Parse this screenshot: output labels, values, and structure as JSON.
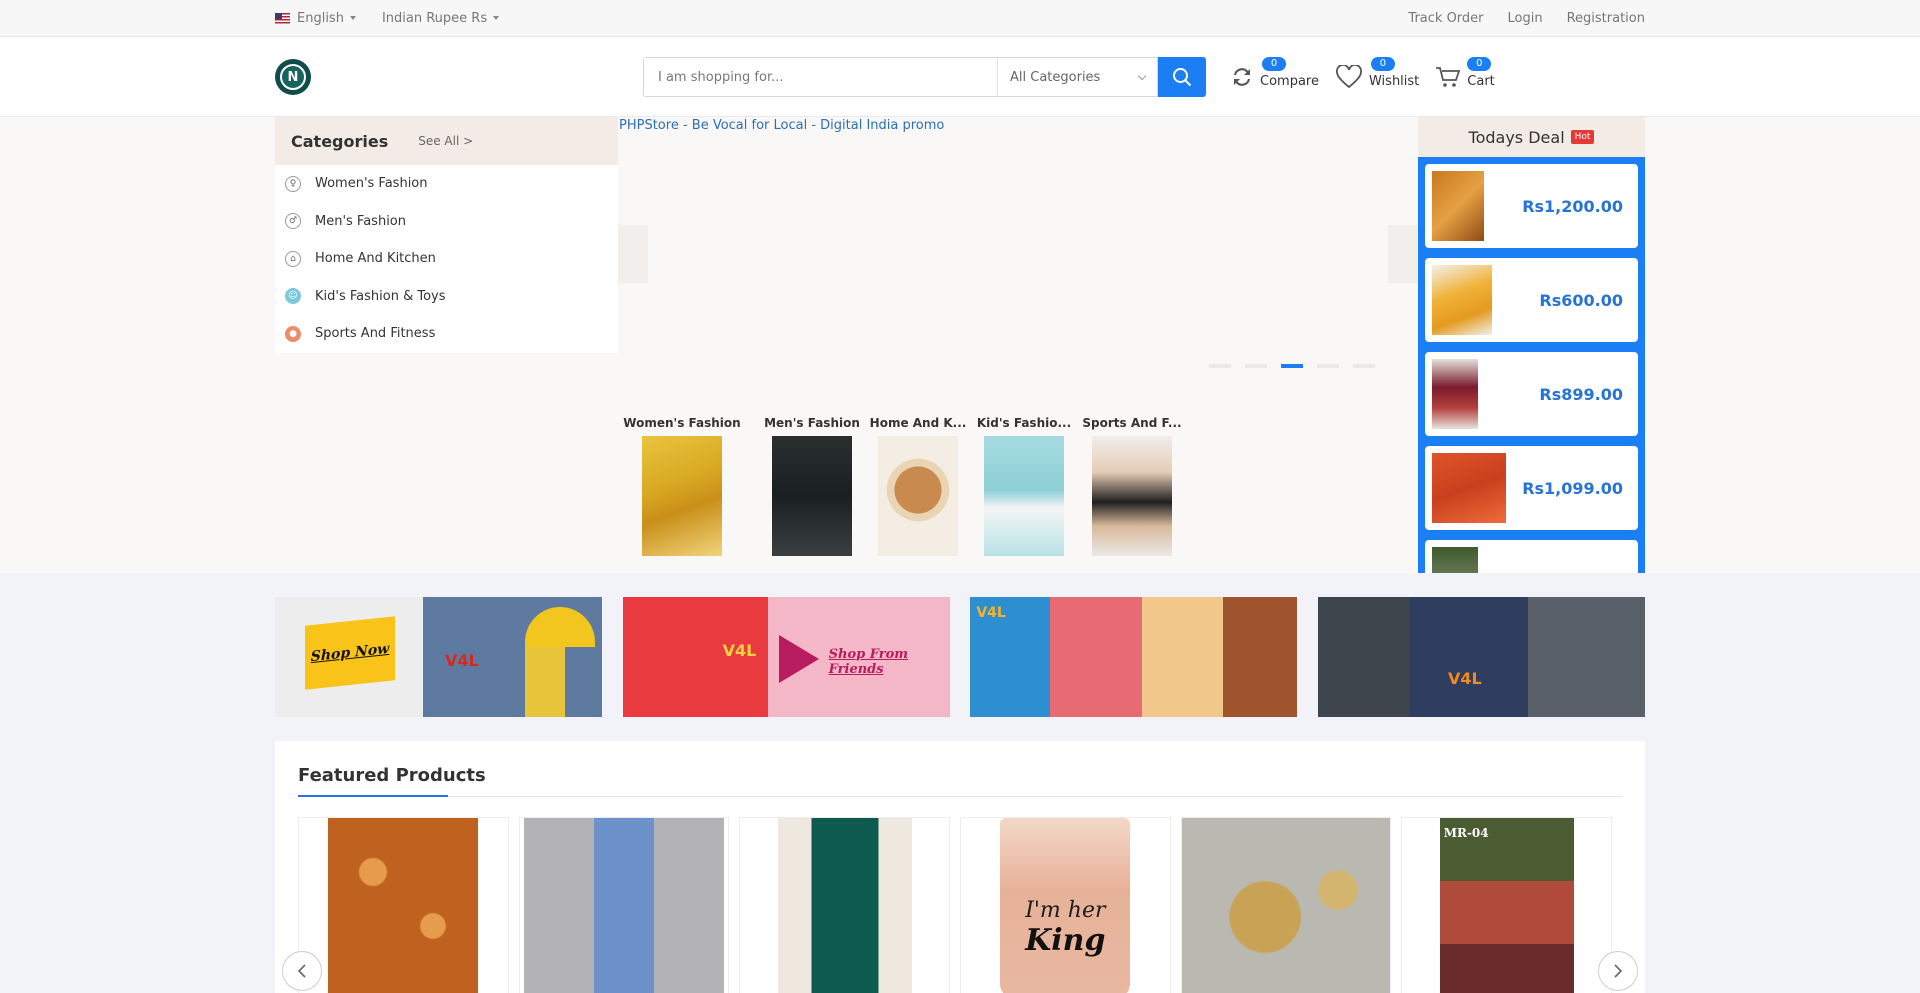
{
  "topbar": {
    "language": "English",
    "currency": "Indian Rupee Rs",
    "links": [
      "Track Order",
      "Login",
      "Registration"
    ]
  },
  "header": {
    "search_placeholder": "I am shopping for...",
    "category_select": "All Categories",
    "compare": {
      "label": "Compare",
      "count": "0"
    },
    "wishlist": {
      "label": "Wishlist",
      "count": "0"
    },
    "cart": {
      "label": "Cart",
      "count": "0"
    }
  },
  "categories": {
    "title": "Categories",
    "see_all": "See All >",
    "items": [
      "Women's Fashion",
      "Men's Fashion",
      "Home And Kitchen",
      "Kid's Fashion & Toys",
      "Sports And Fitness"
    ]
  },
  "slider": {
    "alt_text": "PHPStore - Be Vocal for Local - Digital India promo"
  },
  "mini_categories": [
    "Women's Fashion",
    "Men's Fashion",
    "Home And K...",
    "Kid's Fashio...",
    "Sports And F..."
  ],
  "todays_deal": {
    "title": "Todays Deal",
    "badge": "Hot",
    "prices": [
      "Rs1,200.00",
      "Rs600.00",
      "Rs899.00",
      "Rs1,099.00"
    ]
  },
  "banners": {
    "shop_now": "Shop Now",
    "shop_friends": "Shop From Friends",
    "brand": "V4L"
  },
  "featured": {
    "title": "Featured Products",
    "product_text": [
      "I'm her",
      "King",
      "MR-04"
    ]
  },
  "colors": {
    "accent": "#1b7ef4",
    "price": "#2873d6",
    "hot": "#e53935"
  }
}
